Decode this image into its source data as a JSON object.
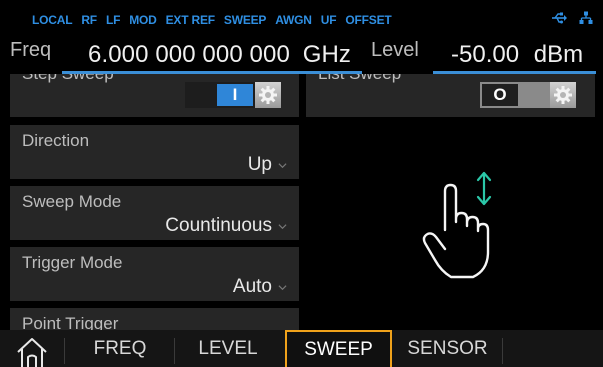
{
  "status_bar": {
    "indicators": [
      "LOCAL",
      "RF",
      "LF",
      "MOD",
      "EXT REF",
      "SWEEP",
      "AWGN",
      "UF",
      "OFFSET"
    ],
    "icons": [
      "usb-icon",
      "lan-icon"
    ]
  },
  "header": {
    "freq_label": "Freq",
    "freq_value": "6.000 000 000 000",
    "freq_unit": "GHz",
    "level_label": "Level",
    "level_value": "-50.00",
    "level_unit": "dBm"
  },
  "step_sweep": {
    "label": "Step Sweep",
    "toggle_state": "on",
    "toggle_glyph": "I"
  },
  "list_sweep": {
    "label": "List Sweep",
    "toggle_state": "off",
    "toggle_glyph": "O"
  },
  "settings": {
    "direction": {
      "label": "Direction",
      "value": "Up"
    },
    "sweep_mode": {
      "label": "Sweep Mode",
      "value": "Countinuous"
    },
    "trigger_mode": {
      "label": "Trigger Mode",
      "value": "Auto"
    },
    "point_trigger": {
      "label": "Point Trigger"
    }
  },
  "scroll_hint_icon": "hand-swipe-vertical-icon",
  "bottom_nav": {
    "home_icon": "home-icon",
    "tabs": [
      "FREQ",
      "LEVEL",
      "SWEEP",
      "SENSOR"
    ],
    "active_tab": "SWEEP"
  },
  "colors": {
    "accent_blue": "#3b8fd7",
    "status_blue": "#2f8fe3",
    "active_tab_border": "#f0a21b",
    "toggle_on": "#2f86d8",
    "panel_bg": "#262626"
  }
}
